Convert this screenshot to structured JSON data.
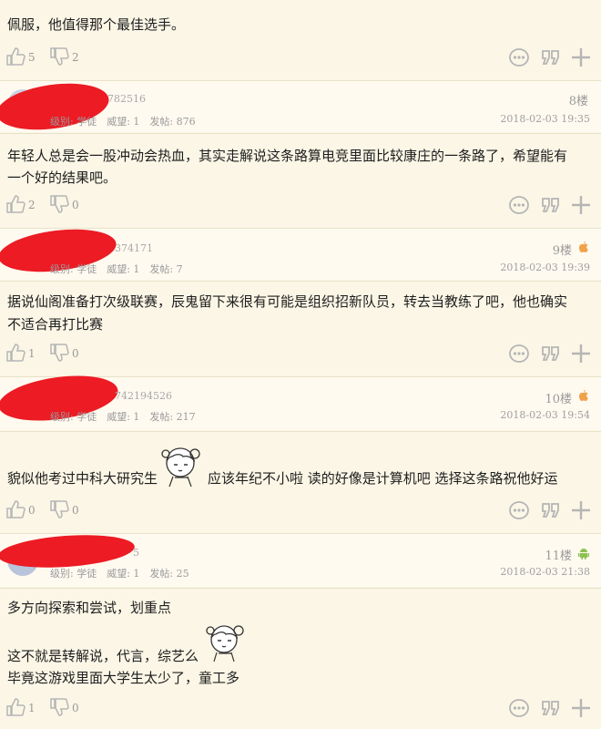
{
  "posts": [
    {
      "body": [
        "佩服，他值得那个最佳选手。"
      ],
      "likes": "5",
      "dislikes": "2"
    },
    {
      "uid": "782516",
      "meta": "级别: 学徒　威望: 1　发帖: 876",
      "floor": "8楼",
      "date": "2018-02-03 19:35",
      "body": [
        "年轻人总是会一股冲动会热血，其实走解说这条路算电竞里面比较康庄的一条路了，希望能有",
        "一个好的结果吧。"
      ],
      "likes": "2",
      "dislikes": "0"
    },
    {
      "uid": "374171",
      "meta": "级别: 学徒　威望: 1　发帖: 7",
      "floor": "9楼",
      "date": "2018-02-03 19:39",
      "platform_icon": "apple-icon",
      "body": [
        "据说仙阁准备打次级联赛，辰鬼留下来很有可能是组织招新队员，转去当教练了吧，他也确实",
        "不适合再打比赛"
      ],
      "likes": "1",
      "dislikes": "0"
    },
    {
      "uid": "742194526",
      "meta": "级别: 学徒　威望: 1　发帖: 217",
      "floor": "10楼",
      "date": "2018-02-03 19:54",
      "platform_icon": "apple-icon",
      "body_a": "貌似他考过中科大研究生",
      "body_b": "应该年纪不小啦 读的好像是计算机吧 选择这条路祝他好运",
      "likes": "0",
      "dislikes": "0"
    },
    {
      "uid": "5",
      "meta": "级别: 学徒　威望: 1　发帖: 25",
      "floor": "11楼",
      "date": "2018-02-03 21:38",
      "platform_icon": "android-icon",
      "body": [
        "多方向探索和尝试，划重点"
      ],
      "body2": [
        "这不就是转解说，代言，综艺么",
        "毕竟这游戏里面大学生太少了，童工多"
      ],
      "likes": "1",
      "dislikes": "0"
    }
  ],
  "colors": {
    "background": "#fbf6e6",
    "icon": "#b9b9b9",
    "scribble": "#ec1b24",
    "apple": "#f0a24a",
    "android": "#8cc152"
  }
}
